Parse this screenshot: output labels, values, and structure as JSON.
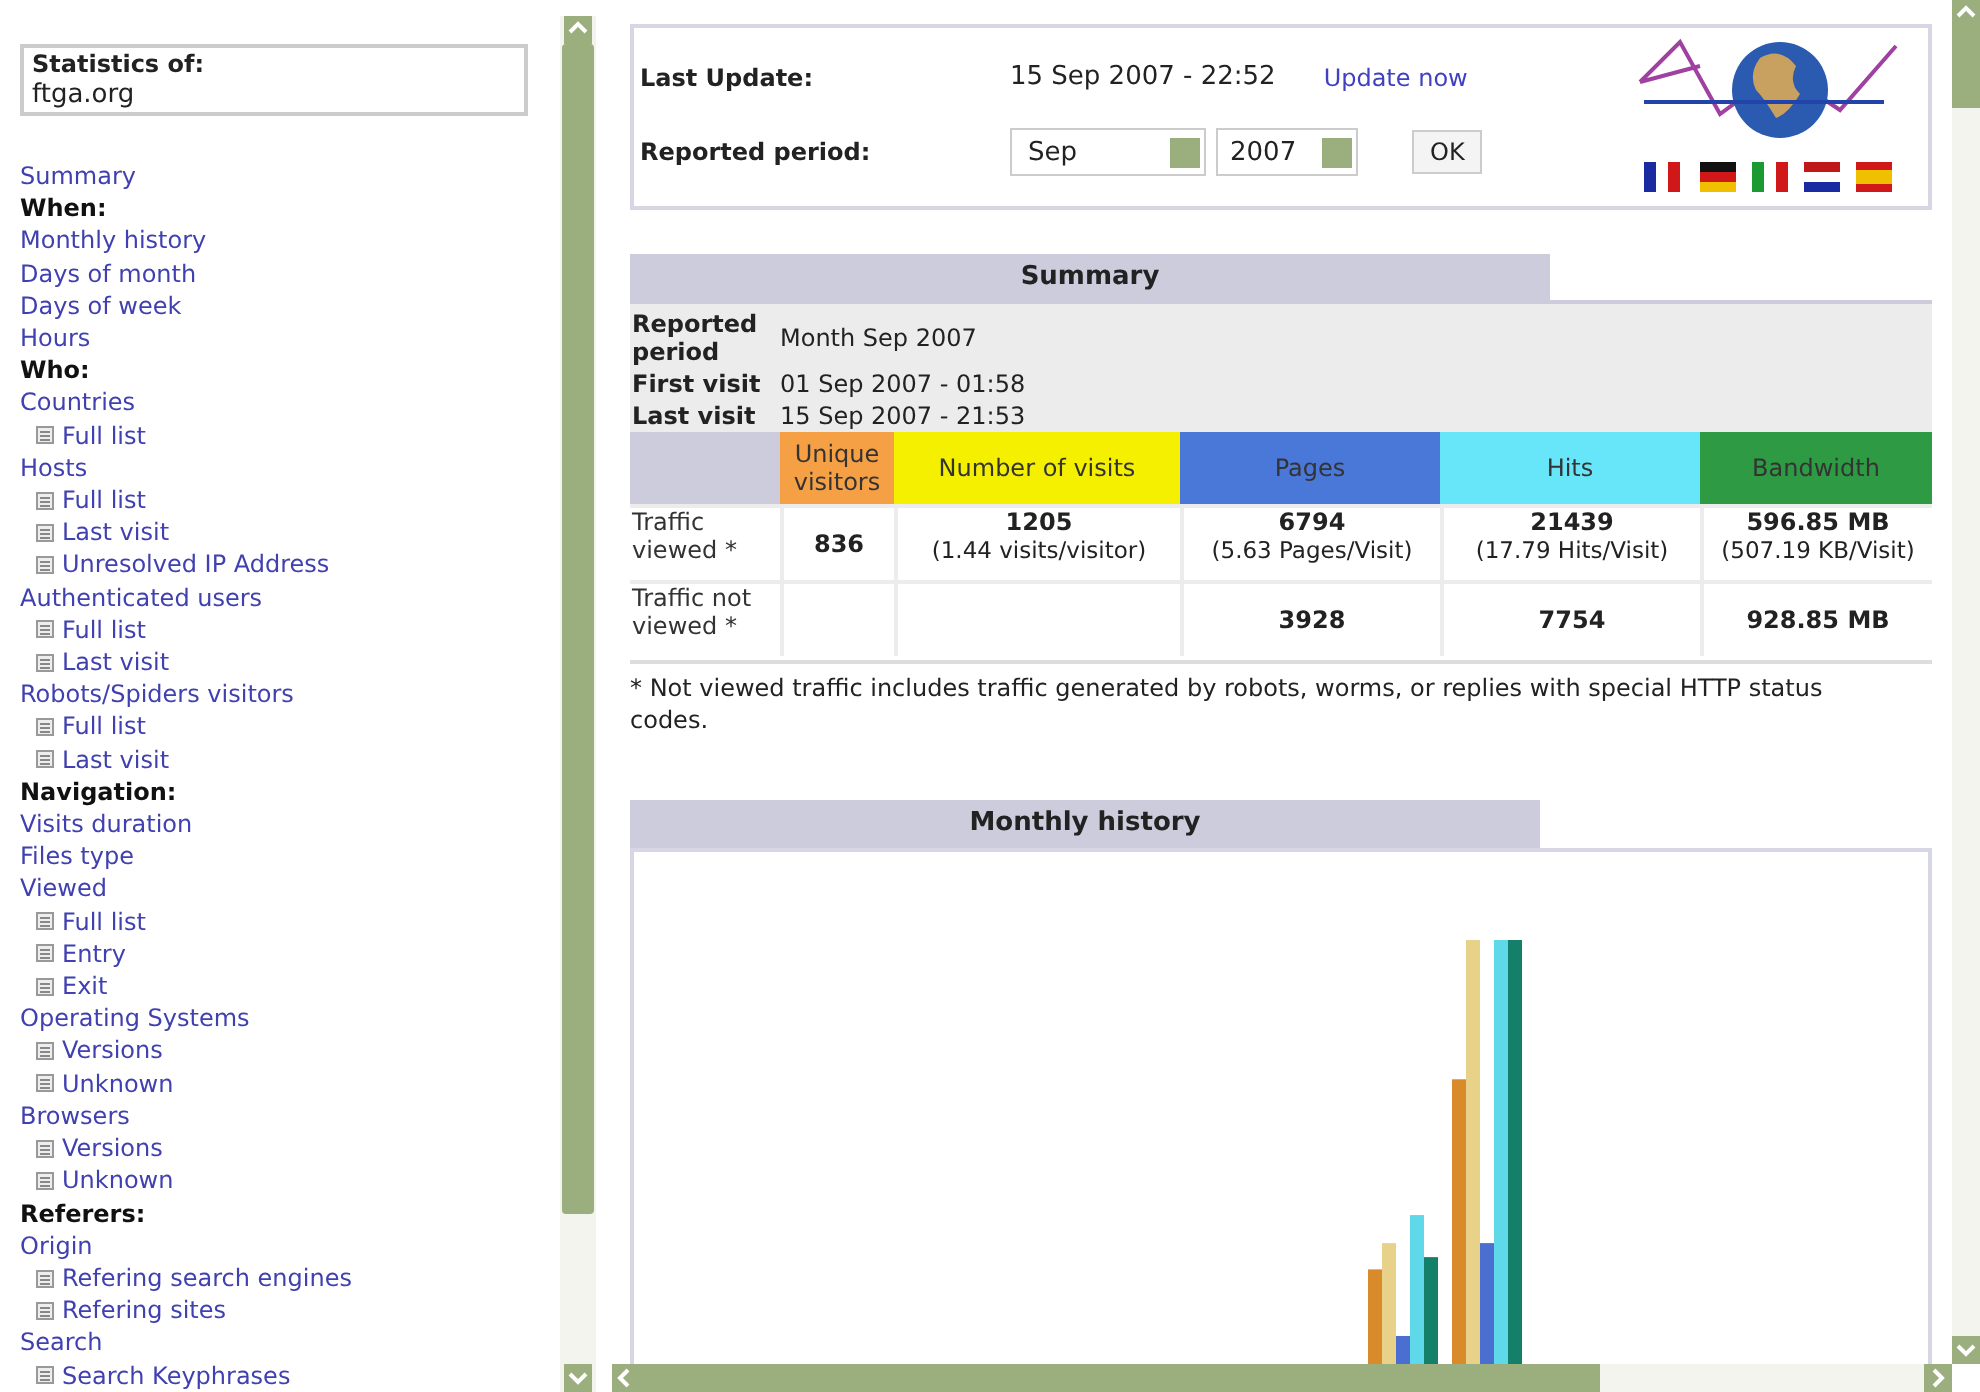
{
  "sidebar": {
    "title": "Statistics of:",
    "site": "ftga.org",
    "items": [
      {
        "kind": "link",
        "label": "Summary"
      },
      {
        "kind": "heading",
        "label": "When:"
      },
      {
        "kind": "link",
        "label": "Monthly history"
      },
      {
        "kind": "link",
        "label": "Days of month"
      },
      {
        "kind": "link",
        "label": "Days of week"
      },
      {
        "kind": "link",
        "label": "Hours"
      },
      {
        "kind": "heading",
        "label": "Who:"
      },
      {
        "kind": "link",
        "label": "Countries"
      },
      {
        "kind": "sublink",
        "label": "Full list"
      },
      {
        "kind": "link",
        "label": "Hosts"
      },
      {
        "kind": "sublink",
        "label": "Full list"
      },
      {
        "kind": "sublink",
        "label": "Last visit"
      },
      {
        "kind": "sublink",
        "label": "Unresolved IP Address"
      },
      {
        "kind": "link",
        "label": "Authenticated users"
      },
      {
        "kind": "sublink",
        "label": "Full list"
      },
      {
        "kind": "sublink",
        "label": "Last visit"
      },
      {
        "kind": "link",
        "label": "Robots/Spiders visitors"
      },
      {
        "kind": "sublink",
        "label": "Full list"
      },
      {
        "kind": "sublink",
        "label": "Last visit"
      },
      {
        "kind": "heading",
        "label": "Navigation:"
      },
      {
        "kind": "link",
        "label": "Visits duration"
      },
      {
        "kind": "link",
        "label": "Files type"
      },
      {
        "kind": "link",
        "label": "Viewed"
      },
      {
        "kind": "sublink",
        "label": "Full list"
      },
      {
        "kind": "sublink",
        "label": "Entry"
      },
      {
        "kind": "sublink",
        "label": "Exit"
      },
      {
        "kind": "link",
        "label": "Operating Systems"
      },
      {
        "kind": "sublink",
        "label": "Versions"
      },
      {
        "kind": "sublink",
        "label": "Unknown"
      },
      {
        "kind": "link",
        "label": "Browsers"
      },
      {
        "kind": "sublink",
        "label": "Versions"
      },
      {
        "kind": "sublink",
        "label": "Unknown"
      },
      {
        "kind": "heading",
        "label": "Referers:"
      },
      {
        "kind": "link",
        "label": "Origin"
      },
      {
        "kind": "sublink",
        "label": "Refering search engines"
      },
      {
        "kind": "sublink",
        "label": "Refering sites"
      },
      {
        "kind": "link",
        "label": "Search"
      },
      {
        "kind": "sublink",
        "label": "Search Keyphrases"
      }
    ]
  },
  "header": {
    "last_update_label": "Last Update:",
    "last_update_value": "15 Sep 2007 - 22:52",
    "update_link": "Update now",
    "period_label": "Reported period:",
    "month": "Sep",
    "year": "2007",
    "ok_button": "OK"
  },
  "summary": {
    "title": "Summary",
    "info": [
      {
        "label": "Reported period",
        "value": "Month Sep 2007"
      },
      {
        "label": "First visit",
        "value": "01 Sep 2007 - 01:58"
      },
      {
        "label": "Last visit",
        "value": "15 Sep 2007 - 21:53"
      }
    ],
    "columns": [
      {
        "label": "Unique visitors",
        "color": "#f5a044"
      },
      {
        "label": "Number of visits",
        "color": "#f5f000"
      },
      {
        "label": "Pages",
        "color": "#4a78d8"
      },
      {
        "label": "Hits",
        "color": "#66e6f8"
      },
      {
        "label": "Bandwidth",
        "color": "#2e9a44"
      }
    ],
    "rows": [
      {
        "label": "Traffic viewed *",
        "cells": [
          {
            "value": "836"
          },
          {
            "value": "1205",
            "sub": "(1.44 visits/visitor)"
          },
          {
            "value": "6794",
            "sub": "(5.63 Pages/Visit)"
          },
          {
            "value": "21439",
            "sub": "(17.79 Hits/Visit)"
          },
          {
            "value": "596.85 MB",
            "sub": "(507.19 KB/Visit)"
          }
        ]
      },
      {
        "label": "Traffic not viewed *",
        "cells": [
          {},
          {},
          {
            "value": "3928"
          },
          {
            "value": "7754"
          },
          {
            "value": "928.85 MB"
          }
        ]
      }
    ],
    "footnote": "* Not viewed traffic includes traffic generated by robots, worms, or replies with special HTTP status codes."
  },
  "monthly_history": {
    "title": "Monthly history"
  }
}
